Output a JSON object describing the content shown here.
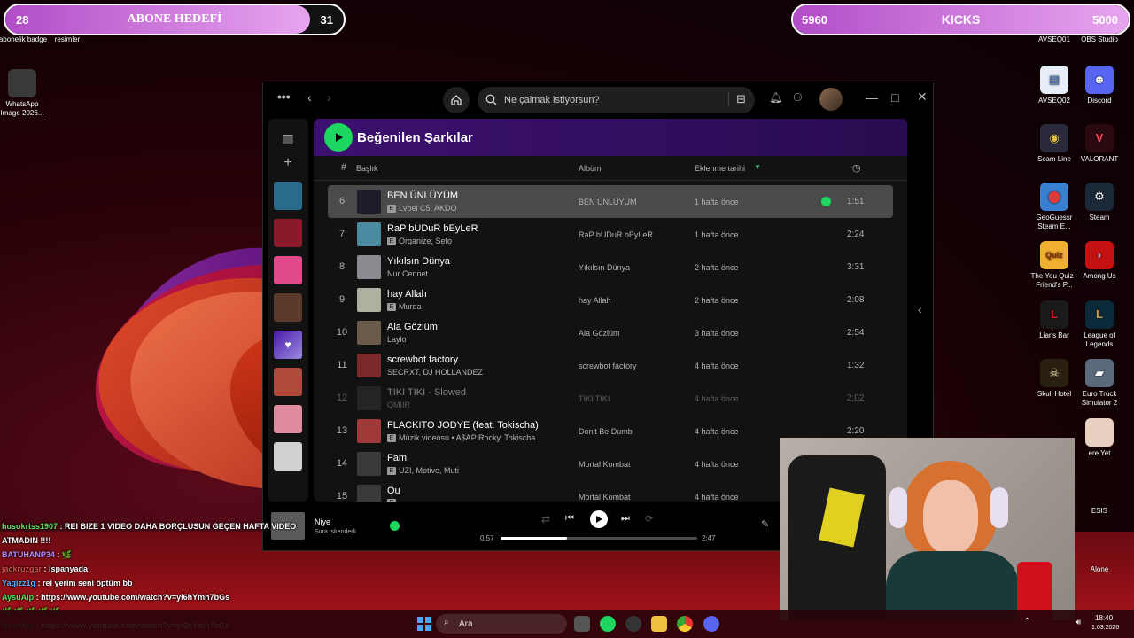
{
  "overlay": {
    "abone": {
      "current": "28",
      "label": "ABONE HEDEFİ",
      "target": "31",
      "progress": 0.9
    },
    "kicks": {
      "current": "5960",
      "label": "KICKS",
      "target": "5000",
      "progress": 1.0
    }
  },
  "desktop_left": [
    {
      "label": "abonelik badge"
    },
    {
      "label": "resimler"
    },
    {
      "label": "WhatsApp Image 2026..."
    }
  ],
  "desktop_right": [
    {
      "label": "AVSEQ01"
    },
    {
      "label": "OBS Studio"
    },
    {
      "label": "AVSEQ02"
    },
    {
      "label": "Discord"
    },
    {
      "label": "Scam Line"
    },
    {
      "label": "VALORANT"
    },
    {
      "label": "GeoGuessr Steam E..."
    },
    {
      "label": "Steam"
    },
    {
      "label": "The You Quiz - Friend's P..."
    },
    {
      "label": "Among Us"
    },
    {
      "label": "Liar's Bar"
    },
    {
      "label": "League of Legends"
    },
    {
      "label": "Skull Hotel"
    },
    {
      "label": "Euro Truck Simulator 2"
    },
    {
      "label": "ere Yet"
    },
    {
      "label": "ESIS"
    },
    {
      "label": "Alone"
    }
  ],
  "spotify": {
    "search_placeholder": "Ne çalmak istiyorsun?",
    "page_title": "Beğenilen Şarkılar",
    "columns": {
      "num": "#",
      "title": "Başlık",
      "album": "Albüm",
      "added": "Eklenme tarihi"
    },
    "tracks": [
      {
        "num": "6",
        "title": "BEN ÜNLÜYÜM",
        "artist": "Lvbel C5, AKDO",
        "explicit": true,
        "album": "BEN ÜNLÜYÜM",
        "added": "1 hafta önce",
        "duration": "1:51",
        "art": "#1c1c2a"
      },
      {
        "num": "7",
        "title": "RaP bUDuR bEyLeR",
        "artist": "Organize, Sefo",
        "explicit": true,
        "album": "RaP bUDuR bEyLeR",
        "added": "1 hafta önce",
        "duration": "2:24",
        "art": "#4a8aa0"
      },
      {
        "num": "8",
        "title": "Yıkılsın Dünya",
        "artist": "Nur Cennet",
        "explicit": false,
        "album": "Yıkılsın Dünya",
        "added": "2 hafta önce",
        "duration": "3:31",
        "art": "#8a8a90"
      },
      {
        "num": "9",
        "title": "hay Allah",
        "artist": "Murda",
        "explicit": true,
        "album": "hay Allah",
        "added": "2 hafta önce",
        "duration": "2:08",
        "art": "#b0b0a0"
      },
      {
        "num": "10",
        "title": "Ala Gözlüm",
        "artist": "Laylo",
        "explicit": false,
        "album": "Ala Gözlüm",
        "added": "3 hafta önce",
        "duration": "2:54",
        "art": "#6a5a4a"
      },
      {
        "num": "11",
        "title": "screwbot factory",
        "artist": "SECRXT, DJ HOLLANDEZ",
        "explicit": false,
        "album": "screwbot factory",
        "added": "4 hafta önce",
        "duration": "1:32",
        "art": "#7a2a2a"
      },
      {
        "num": "12",
        "title": "TIKI TIKI - Slowed",
        "artist": "QMIIR",
        "explicit": false,
        "album": "TIKI TIKI",
        "added": "4 hafta önce",
        "duration": "2:02",
        "art": "#3a3a3a"
      },
      {
        "num": "13",
        "title": "FLACKITO JODYE (feat. Tokischa)",
        "artist": "Müzik videosu • A$AP Rocky, Tokischa",
        "explicit": true,
        "album": "Don't Be Dumb",
        "added": "4 hafta önce",
        "duration": "2:20",
        "art": "#a03a3a"
      },
      {
        "num": "14",
        "title": "Fam",
        "artist": "UZI, Motive, Muti",
        "explicit": true,
        "album": "Mortal Kombat",
        "added": "4 hafta önce",
        "duration": "",
        "art": "#3a3a3a"
      },
      {
        "num": "15",
        "title": "Ou",
        "artist": "",
        "explicit": true,
        "album": "Mortal Kombat",
        "added": "4 hafta önce",
        "duration": "",
        "art": "#3a3a3a"
      }
    ],
    "now_playing": {
      "title": "Niye",
      "artist": "Sura İskenderli",
      "elapsed": "0:57",
      "total": "2:47",
      "progress": 0.34
    }
  },
  "chat": [
    {
      "user": "husokrtss1907",
      "color": "#5ee05e",
      "text": "REI BIZE 1 VIDEO DAHA BORÇLUSUN GEÇEN HAFTA VIDEO ATMADIN !!!!"
    },
    {
      "user": "BATUHANP34",
      "color": "#b58cff",
      "text": "🌿"
    },
    {
      "user": "jackruzgar",
      "color": "#e04a4a",
      "text": "ispanyada"
    },
    {
      "user": "Yagizz1g",
      "color": "#5ab0ff",
      "text": "rei yerim seni öptüm bb"
    },
    {
      "user": "AysuAlp",
      "color": "#5ee05e",
      "text": "https://www.youtube.com/watch?v=yl6hYmh7bGs"
    },
    {
      "user": "",
      "color": "#e04a4a",
      "text": "🌿 🌿 🌿 🌿 🌿"
    },
    {
      "user": "AysuAlp",
      "color": "#5ee05e",
      "text": "https://www.youtube.com/watch?v=yl6hYmh7bGs"
    }
  ],
  "taskbar": {
    "search_label": "Ara",
    "time": "18:40",
    "date": "1.03.2026"
  }
}
